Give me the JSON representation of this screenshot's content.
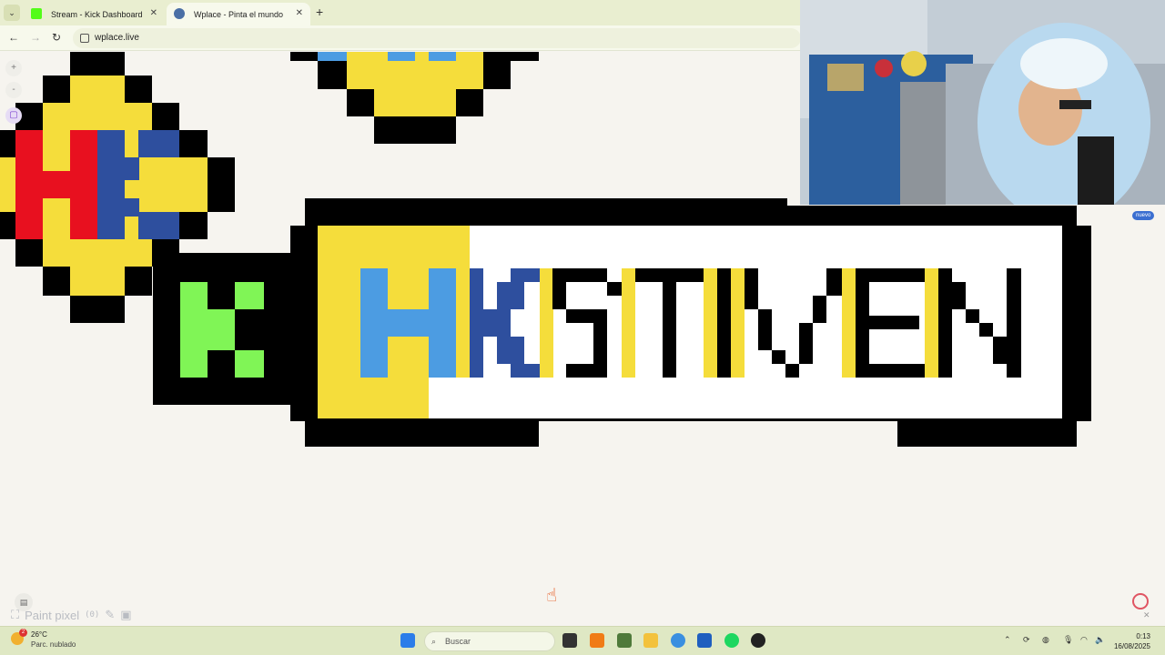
{
  "browser": {
    "tabs": [
      {
        "label": "Stream - Kick Dashboard",
        "favicon_color": "#53fc18",
        "active": false
      },
      {
        "label": "Wplace - Pinta el mundo",
        "favicon_color": "#4a6fa5",
        "active": true
      }
    ],
    "url": "wplace.live"
  },
  "page": {
    "paint_label": "Paint pixel",
    "paint_count": "(0)",
    "nuevo_badge": "nuevo"
  },
  "colors": {
    "black": "#000000",
    "yellow": "#f5dd3b",
    "red": "#e8101f",
    "dark_blue": "#2e4f9e",
    "light_blue": "#4c9ce2",
    "green": "#80f556",
    "white": "#ffffff",
    "canvas_bg": "#f6f4ef"
  },
  "taskbar": {
    "weather_temp": "26°C",
    "weather_desc": "Parc. nublado",
    "weather_badge": "2",
    "search_placeholder": "Buscar",
    "time": "0:13",
    "date": "16/08/2025"
  }
}
